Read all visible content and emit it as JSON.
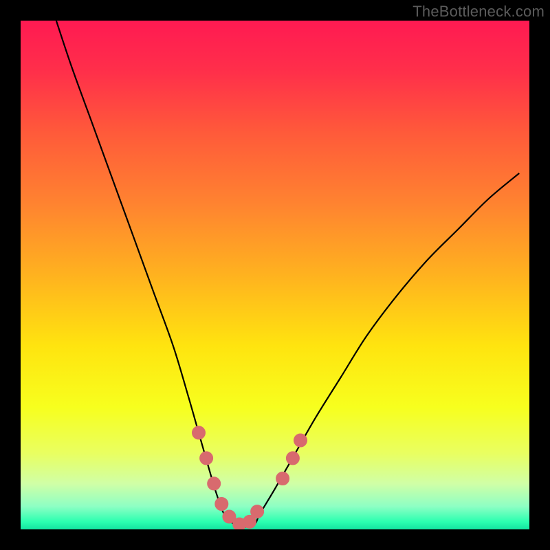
{
  "watermark": "TheBottleneck.com",
  "colors": {
    "frame": "#000000",
    "curve_stroke": "#000000",
    "marker_fill": "#d86a6e",
    "marker_stroke": "#d86a6e",
    "gradient_stops": [
      {
        "offset": 0.0,
        "color": "#ff1a52"
      },
      {
        "offset": 0.1,
        "color": "#ff2f4a"
      },
      {
        "offset": 0.22,
        "color": "#ff5a3a"
      },
      {
        "offset": 0.36,
        "color": "#ff8330"
      },
      {
        "offset": 0.5,
        "color": "#ffb21f"
      },
      {
        "offset": 0.64,
        "color": "#ffe40f"
      },
      {
        "offset": 0.76,
        "color": "#f7ff1e"
      },
      {
        "offset": 0.85,
        "color": "#e9ff60"
      },
      {
        "offset": 0.91,
        "color": "#d0ffa6"
      },
      {
        "offset": 0.955,
        "color": "#8dffc4"
      },
      {
        "offset": 0.985,
        "color": "#2bffb0"
      },
      {
        "offset": 1.0,
        "color": "#14e3a0"
      }
    ]
  },
  "chart_data": {
    "type": "line",
    "title": "",
    "xlabel": "",
    "ylabel": "",
    "xlim": [
      0,
      100
    ],
    "ylim": [
      0,
      100
    ],
    "grid": false,
    "series": [
      {
        "name": "bottleneck-curve",
        "x": [
          7,
          10,
          14,
          18,
          22,
          26,
          30,
          33,
          35,
          37,
          38.5,
          40,
          42,
          44,
          46,
          47,
          50,
          54,
          58,
          63,
          68,
          74,
          80,
          86,
          92,
          98
        ],
        "y": [
          100,
          91,
          80,
          69,
          58,
          47,
          36,
          26,
          19,
          12,
          7,
          3,
          1,
          0.5,
          1,
          3,
          8,
          15,
          22,
          30,
          38,
          46,
          53,
          59,
          65,
          70
        ]
      }
    ],
    "markers": {
      "name": "highlight-dots",
      "x": [
        35,
        36.5,
        38,
        39.5,
        41,
        43,
        45,
        46.5,
        51.5,
        53.5,
        55
      ],
      "y": [
        19,
        14,
        9,
        5,
        2.5,
        1,
        1.5,
        3.5,
        10,
        14,
        17.5
      ]
    }
  }
}
